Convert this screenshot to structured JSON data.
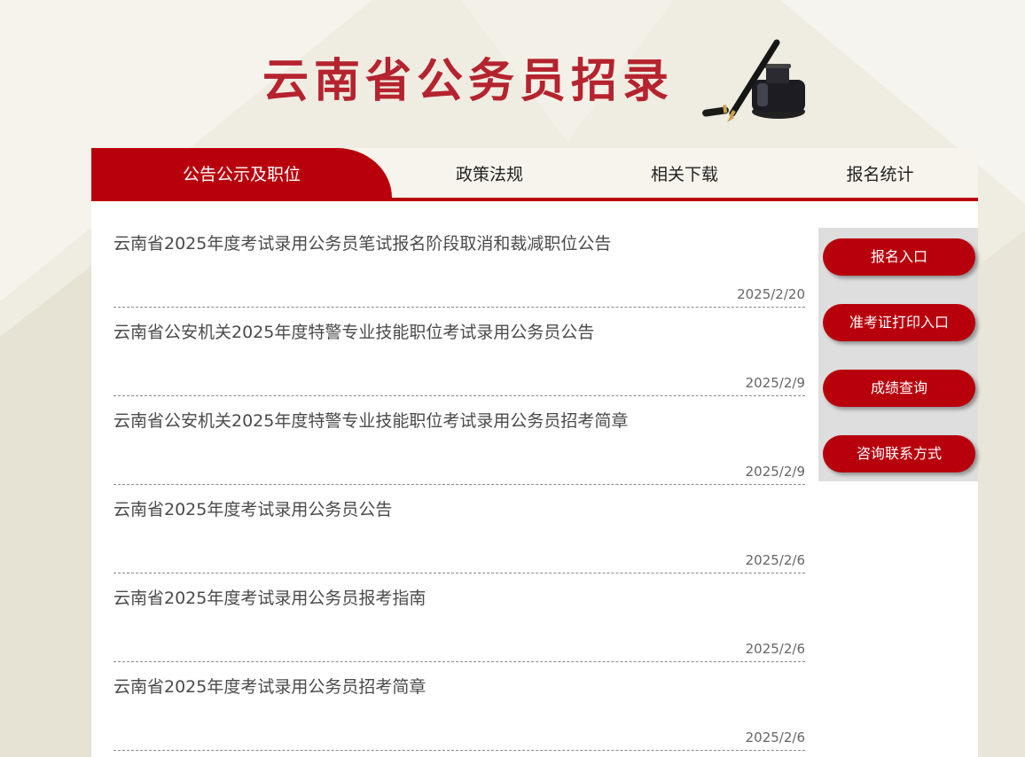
{
  "header": {
    "title": "云南省公务员招录",
    "decoration_icon": "pen-and-ink-icon"
  },
  "nav": {
    "tabs": [
      {
        "label": "公告公示及职位",
        "active": true
      },
      {
        "label": "政策法规",
        "active": false
      },
      {
        "label": "相关下载",
        "active": false
      },
      {
        "label": "报名统计",
        "active": false
      }
    ]
  },
  "news": {
    "items": [
      {
        "title": "云南省2025年度考试录用公务员笔试报名阶段取消和裁减职位公告",
        "date": "2025/2/20"
      },
      {
        "title": "云南省公安机关2025年度特警专业技能职位考试录用公务员公告",
        "date": "2025/2/9"
      },
      {
        "title": "云南省公安机关2025年度特警专业技能职位考试录用公务员招考简章",
        "date": "2025/2/9"
      },
      {
        "title": "云南省2025年度考试录用公务员公告",
        "date": "2025/2/6"
      },
      {
        "title": "云南省2025年度考试录用公务员报考指南",
        "date": "2025/2/6"
      },
      {
        "title": "云南省2025年度考试录用公务员招考简章",
        "date": "2025/2/6"
      }
    ]
  },
  "sidebar": {
    "buttons": [
      {
        "label": "报名入口"
      },
      {
        "label": "准考证打印入口"
      },
      {
        "label": "成绩查询"
      },
      {
        "label": "咨询联系方式"
      }
    ]
  },
  "colors": {
    "accent": "#b8000c",
    "title": "#b5232f",
    "background": "#eeebe0"
  }
}
